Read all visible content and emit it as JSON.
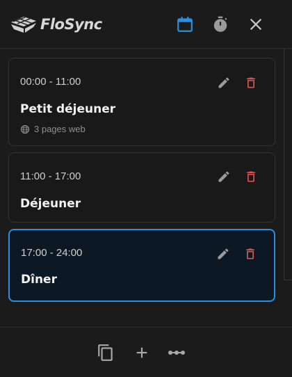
{
  "app": {
    "name": "FloSync"
  },
  "colors": {
    "accent": "#2a8fe0",
    "danger": "#e05252",
    "muted": "#9a9a9a"
  },
  "header": {
    "icons": [
      "calendar-icon",
      "timer-icon",
      "close-icon"
    ]
  },
  "meals": [
    {
      "time": "00:00 - 11:00",
      "title": "Petit déjeuner",
      "subtitle": "3 pages web",
      "selected": false
    },
    {
      "time": "11:00 - 17:00",
      "title": "Déjeuner",
      "selected": false
    },
    {
      "time": "17:00 - 24:00",
      "title": "Dîner",
      "selected": true
    }
  ],
  "footer": {
    "icons": [
      "duplicate-icon",
      "add-icon",
      "more-icon"
    ]
  }
}
